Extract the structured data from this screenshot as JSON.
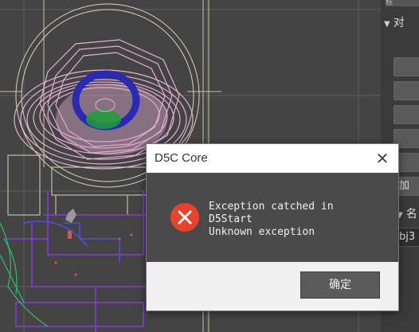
{
  "dialog": {
    "title": "D5C Core",
    "message_lines": [
      "Exception catched in",
      "D5Start",
      "Unknown exception"
    ],
    "ok_label": "确定",
    "close_glyph": "✕",
    "icon": "error-icon",
    "icon_color": "#e8412c"
  },
  "right_panel": {
    "top_label": "标",
    "section1_title": "对",
    "field_add": "加",
    "section2_title": "名",
    "name_value": "bj3"
  },
  "colors": {
    "viewport_bg": "#444444",
    "wire_pink": "#e6b0d8",
    "wire_blue": "#2a2ab5",
    "wire_green": "#1e9e3a",
    "wire_purple": "#8a3be0"
  }
}
